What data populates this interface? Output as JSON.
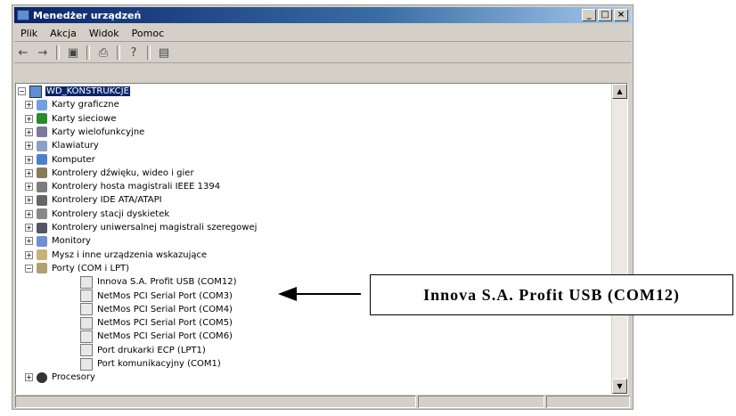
{
  "window": {
    "title": "Menedżer urządzeń"
  },
  "titlebar_buttons": {
    "minimize": "_",
    "maximize": "□",
    "close": "×"
  },
  "menu": [
    "Plik",
    "Akcja",
    "Widok",
    "Pomoc"
  ],
  "toolbar": [
    "back-icon",
    "forward-icon",
    "properties-icon",
    "print-icon",
    "help-icon",
    "scan-icon"
  ],
  "tree": {
    "root": "WD_KONSTRUKCJE",
    "items": [
      {
        "label": "Karty graficzne",
        "exp": "+"
      },
      {
        "label": "Karty sieciowe",
        "exp": "+"
      },
      {
        "label": "Karty wielofunkcyjne",
        "exp": "+"
      },
      {
        "label": "Klawiatury",
        "exp": "+"
      },
      {
        "label": "Komputer",
        "exp": "+"
      },
      {
        "label": "Kontrolery dźwięku, wideo i gier",
        "exp": "+"
      },
      {
        "label": "Kontrolery hosta magistrali IEEE 1394",
        "exp": "+"
      },
      {
        "label": "Kontrolery IDE ATA/ATAPI",
        "exp": "+"
      },
      {
        "label": "Kontrolery stacji dyskietek",
        "exp": "+"
      },
      {
        "label": "Kontrolery uniwersalnej magistrali szeregowej",
        "exp": "+"
      },
      {
        "label": "Monitory",
        "exp": "+"
      },
      {
        "label": "Mysz i inne urządzenia wskazujące",
        "exp": "+"
      },
      {
        "label": "Porty (COM i LPT)",
        "exp": "−"
      }
    ],
    "ports": [
      "Innova S.A. Profit USB (COM12)",
      "NetMos PCI Serial Port (COM3)",
      "NetMos PCI Serial Port (COM4)",
      "NetMos PCI Serial Port (COM5)",
      "NetMos PCI Serial Port (COM6)",
      "Port drukarki ECP (LPT1)",
      "Port komunikacyjny (COM1)"
    ],
    "last": "Procesory"
  },
  "callout": {
    "text": "Innova S.A. Profit USB (COM12)"
  },
  "colors": {
    "selection": "#0a246a",
    "titlebar": "#0a246a"
  }
}
